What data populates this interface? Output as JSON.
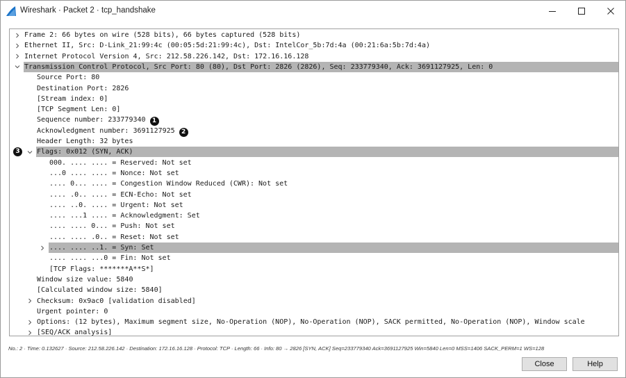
{
  "window": {
    "title": "Wireshark · Packet 2 · tcp_handshake"
  },
  "tree": {
    "rows": [
      {
        "text": "Frame 2: 66 bytes on wire (528 bits), 66 bytes captured (528 bits)",
        "level": 0,
        "expander": "collapsed"
      },
      {
        "text": "Ethernet II, Src: D-Link_21:99:4c (00:05:5d:21:99:4c), Dst: IntelCor_5b:7d:4a (00:21:6a:5b:7d:4a)",
        "level": 0,
        "expander": "collapsed"
      },
      {
        "text": "Internet Protocol Version 4, Src: 212.58.226.142, Dst: 172.16.16.128",
        "level": 0,
        "expander": "collapsed"
      },
      {
        "text": "Transmission Control Protocol, Src Port: 80 (80), Dst Port: 2826 (2826), Seq: 233779340, Ack: 3691127925, Len: 0",
        "level": 0,
        "expander": "expanded",
        "highlight": true
      },
      {
        "text": "Source Port: 80",
        "level": 1,
        "expander": "none"
      },
      {
        "text": "Destination Port: 2826",
        "level": 1,
        "expander": "none"
      },
      {
        "text": "[Stream index: 0]",
        "level": 1,
        "expander": "none"
      },
      {
        "text": "[TCP Segment Len: 0]",
        "level": 1,
        "expander": "none"
      },
      {
        "text": "Sequence number: 233779340",
        "level": 1,
        "expander": "none",
        "badge": "1"
      },
      {
        "text": "Acknowledgment number: 3691127925",
        "level": 1,
        "expander": "none",
        "badge": "2"
      },
      {
        "text": "Header Length: 32 bytes",
        "level": 1,
        "expander": "none"
      },
      {
        "text": "Flags: 0x012 (SYN, ACK)",
        "level": 1,
        "expander": "expanded",
        "highlight": true,
        "leftBadge": "3"
      },
      {
        "text": "000. .... .... = Reserved: Not set",
        "level": 2,
        "expander": "none"
      },
      {
        "text": "...0 .... .... = Nonce: Not set",
        "level": 2,
        "expander": "none"
      },
      {
        "text": ".... 0... .... = Congestion Window Reduced (CWR): Not set",
        "level": 2,
        "expander": "none"
      },
      {
        "text": ".... .0.. .... = ECN-Echo: Not set",
        "level": 2,
        "expander": "none"
      },
      {
        "text": ".... ..0. .... = Urgent: Not set",
        "level": 2,
        "expander": "none"
      },
      {
        "text": ".... ...1 .... = Acknowledgment: Set",
        "level": 2,
        "expander": "none"
      },
      {
        "text": ".... .... 0... = Push: Not set",
        "level": 2,
        "expander": "none"
      },
      {
        "text": ".... .... .0.. = Reset: Not set",
        "level": 2,
        "expander": "none"
      },
      {
        "text": ".... .... ..1. = Syn: Set",
        "level": 2,
        "expander": "collapsed",
        "highlight": true
      },
      {
        "text": ".... .... ...0 = Fin: Not set",
        "level": 2,
        "expander": "none"
      },
      {
        "text": "[TCP Flags: *******A**S*]",
        "level": 2,
        "expander": "none"
      },
      {
        "text": "Window size value: 5840",
        "level": 1,
        "expander": "none"
      },
      {
        "text": "[Calculated window size: 5840]",
        "level": 1,
        "expander": "none"
      },
      {
        "text": "Checksum: 0x9ac0 [validation disabled]",
        "level": 1,
        "expander": "collapsed"
      },
      {
        "text": "Urgent pointer: 0",
        "level": 1,
        "expander": "none"
      },
      {
        "text": "Options: (12 bytes), Maximum segment size, No-Operation (NOP), No-Operation (NOP), SACK permitted, No-Operation (NOP), Window scale",
        "level": 1,
        "expander": "collapsed"
      },
      {
        "text": "[SEQ/ACK analysis]",
        "level": 1,
        "expander": "collapsed"
      }
    ]
  },
  "status": {
    "text": "No.: 2 · Time: 0.132627 · Source: 212.58.226.142 · Destination: 172.16.16.128 · Protocol: TCP · Length: 66 · Info: 80 → 2826 [SYN, ACK] Seq=233779340 Ack=3691127925 Win=5840 Len=0 MSS=1406 SACK_PERM=1 WS=128"
  },
  "buttons": {
    "close": "Close",
    "help": "Help"
  },
  "colors": {
    "highlight": "#b4b4b4",
    "badge": "#111111",
    "fin": "#1a73c8"
  },
  "icons": {
    "app": "shark-fin-icon",
    "minimize": "minimize-icon",
    "maximize": "maximize-icon",
    "close": "close-icon",
    "collapsed": "chevron-right-icon",
    "expanded": "chevron-down-icon"
  }
}
